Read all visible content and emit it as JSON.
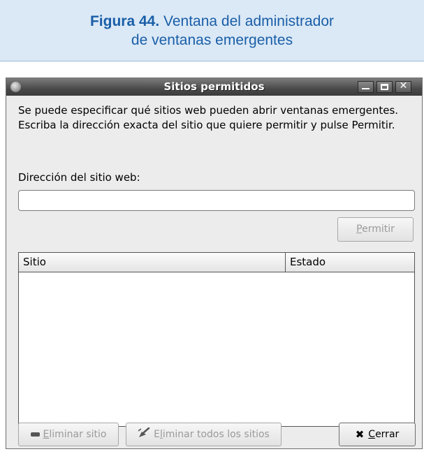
{
  "caption": {
    "label": "Figura 44.",
    "line1": "Ventana del administrador",
    "line2": "de ventanas emergentes"
  },
  "window": {
    "title": "Sitios permitidos",
    "description": "Se puede especificar qué sitios web pueden abrir ventanas emergentes. Escriba la dirección exacta del sitio que quiere permitir y pulse Permitir.",
    "address_label": "Dirección del sitio web:",
    "address_value": "",
    "permit_mnemonic": "P",
    "permit_rest": "ermitir",
    "columns": [
      "Sitio",
      "Estado"
    ],
    "remove_mnemonic": "E",
    "remove_rest": "liminar sitio",
    "remove_all_pre": "E",
    "remove_all_mnemonic": "l",
    "remove_all_rest": "iminar todos los sitios",
    "close_mnemonic": "C",
    "close_rest": "errar"
  }
}
